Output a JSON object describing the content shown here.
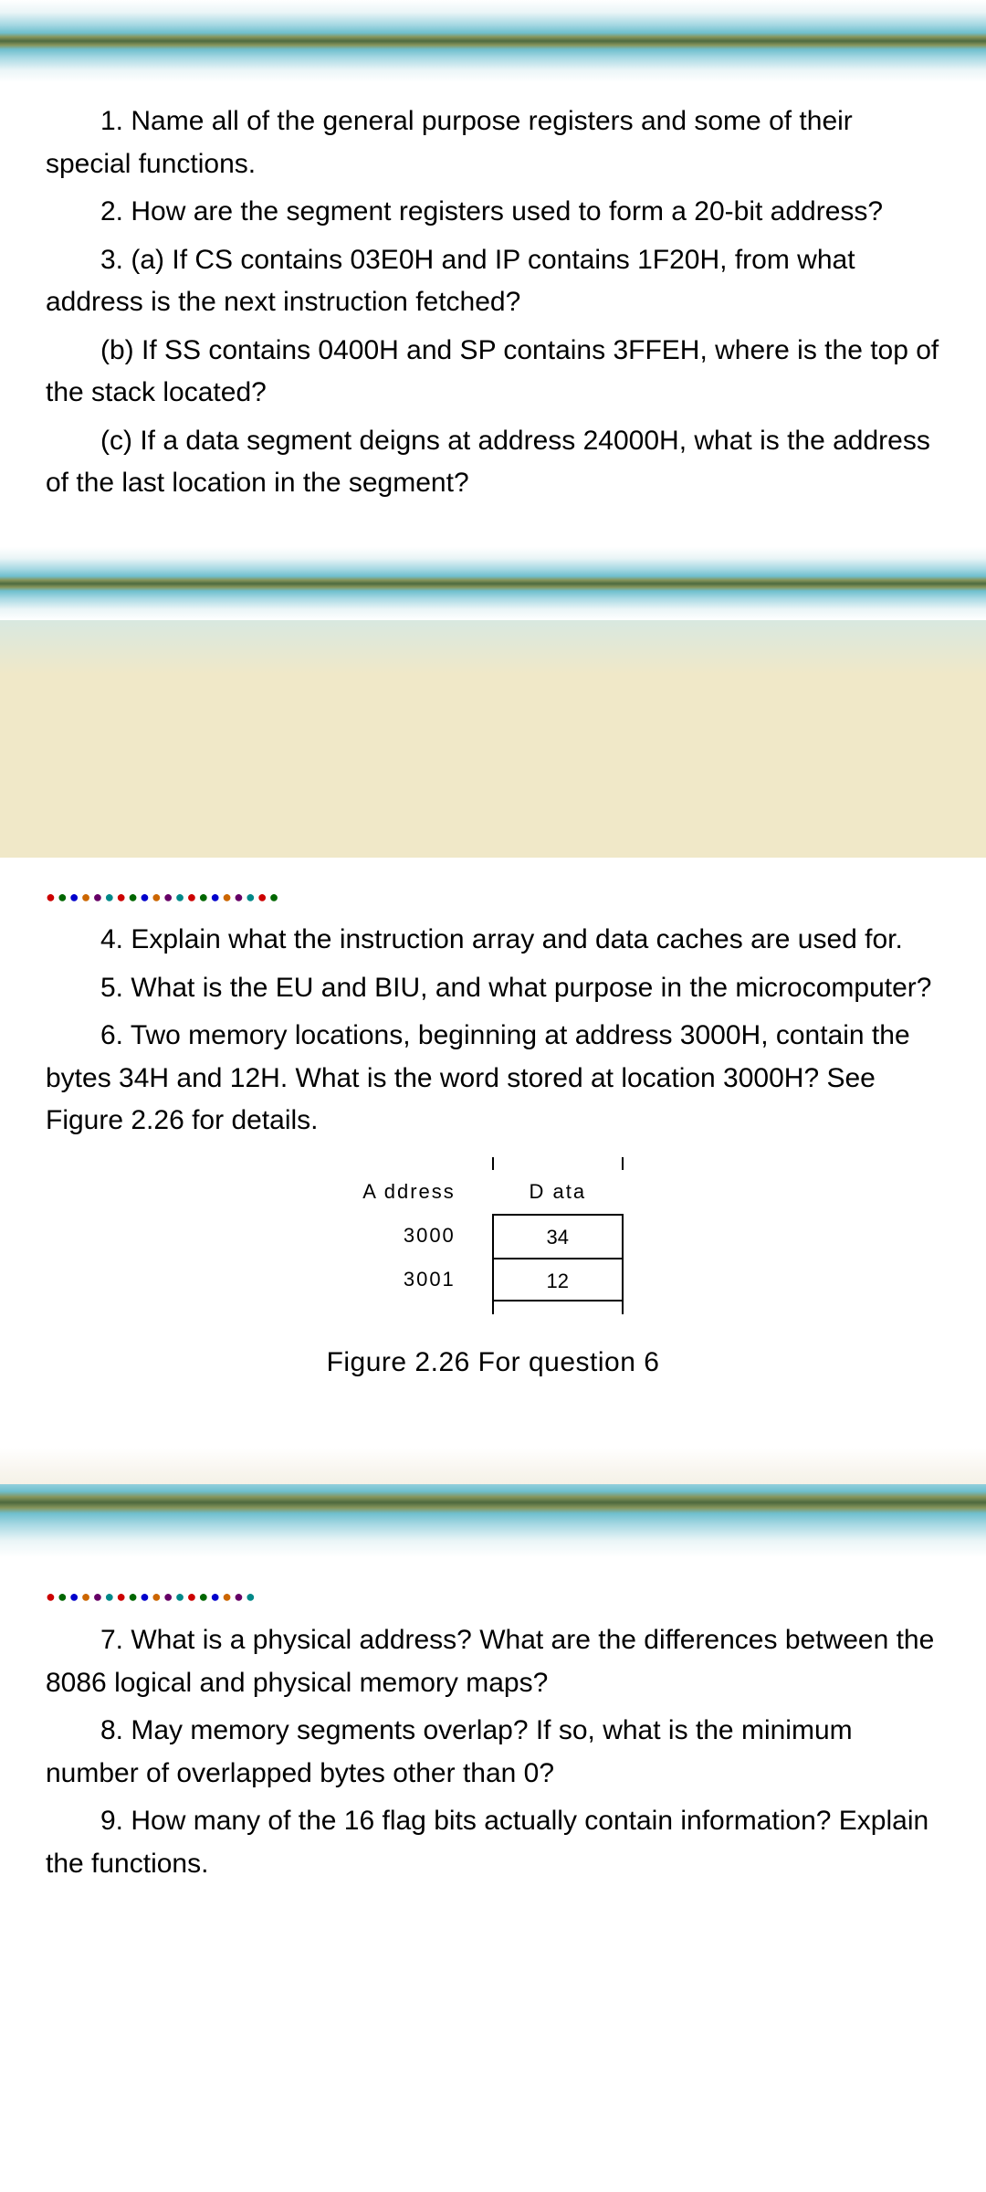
{
  "section1": {
    "q1": "1.  Name all of the general purpose registers and some of their special functions.",
    "q2": "2.  How are the segment registers used to form a 20-bit address?",
    "q3a": "3.  (a) If CS contains 03E0H and IP contains 1F20H, from what address is the next instruction  fetched?",
    "q3b": "(b) If SS contains 0400H and SP contains 3FFEH, where is the top of the stack located?",
    "q3c": "(c) If a data segment deigns at address 24000H, what is the address of the last location in the segment?"
  },
  "section2": {
    "q4": "4.  Explain what the instruction array and data caches are used for.",
    "q5": "5.  What is the EU and BIU, and what purpose in the microcomputer?",
    "q6": "6. Two memory locations, beginning at address 3000H, contain the bytes 34H and 12H. What is the word stored at location 3000H? See Figure 2.26 for details."
  },
  "figure": {
    "addr_header": "A ddress",
    "data_header": "D ata",
    "rows": [
      {
        "addr": "3000",
        "data": "34"
      },
      {
        "addr": "3001",
        "data": "12"
      }
    ],
    "caption": "Figure 2.26  For question 6"
  },
  "section3": {
    "q7": "7.  What is a physical address? What are the differences between the 8086 logical and physical memory maps?",
    "q8": "8. May memory segments overlap? If so, what is the minimum number of overlapped bytes other than 0?",
    "q9": "9.  How many of the 16 flag bits actually contain information? Explain the functions."
  }
}
